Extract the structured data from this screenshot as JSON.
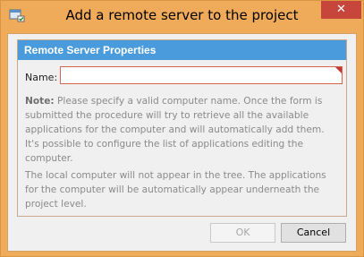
{
  "window": {
    "title": "Add a remote server to the project",
    "close_label": "✕",
    "icon": "app-window-icon"
  },
  "group": {
    "header": "Remote Server Properties"
  },
  "form": {
    "name_label": "Name:",
    "name_value": "",
    "name_placeholder": ""
  },
  "note": {
    "prefix": "Note:",
    "text": " Please specify a valid computer name. Once the form is submitted the procedure will try to retrieve all the available applications for the computer and will automatically add them. It's possible to configure the list of applications editing the computer."
  },
  "info": {
    "text": "The local computer will not appear in the tree. The applications for the computer will be automatically appear underneath the project level."
  },
  "buttons": {
    "ok_label": "OK",
    "cancel_label": "Cancel"
  },
  "colors": {
    "title_bar": "#f0ab5a",
    "close_button": "#c7463b",
    "group_header": "#4a9bdb",
    "invalid_border": "#d26455"
  }
}
